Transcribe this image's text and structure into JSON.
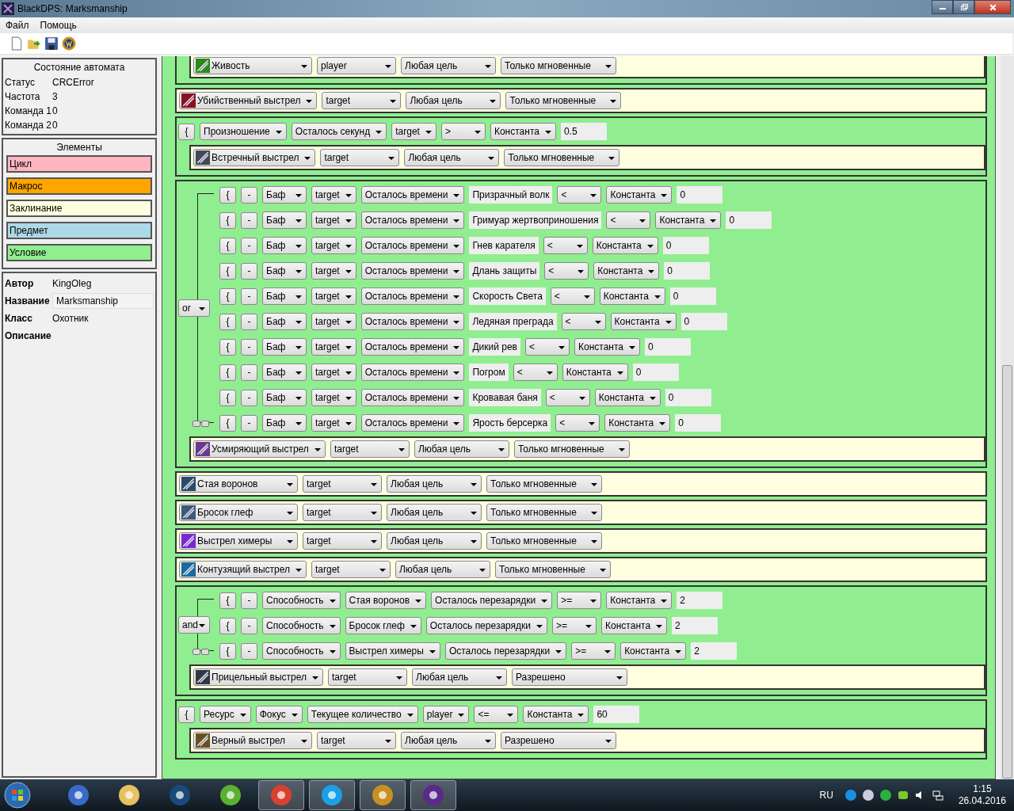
{
  "window": {
    "title": "BlackDPS: Marksmanship"
  },
  "menu": [
    "Файл",
    "Помощь"
  ],
  "status": {
    "title": "Состояние автомата",
    "rows": [
      {
        "label": "Статус",
        "value": "CRCError"
      },
      {
        "label": "Частота",
        "value": "3"
      },
      {
        "label": "Команда 1",
        "value": "0"
      },
      {
        "label": "Команда 2",
        "value": "0"
      }
    ]
  },
  "elements": {
    "title": "Элементы",
    "items": [
      {
        "label": "Цикл",
        "color": "#ffb6c1"
      },
      {
        "label": "Макрос",
        "color": "#ffa500"
      },
      {
        "label": "Заклинание",
        "color": "#ffffe0"
      },
      {
        "label": "Предмет",
        "color": "#add8e6"
      },
      {
        "label": "Условие",
        "color": "#90ee90"
      }
    ]
  },
  "info": {
    "author_label": "Автор",
    "author": "KingOleg",
    "name_label": "Название",
    "name": "Marksmanship",
    "class_label": "Класс",
    "class": "Охотник",
    "description_label": "Описание"
  },
  "blocks": [
    {
      "kind": "condition",
      "cut": true,
      "spell": {
        "name": "Живость",
        "unit": "player",
        "target": "Любая цель",
        "mode": "Только мгновенные"
      }
    },
    {
      "kind": "spell",
      "spell": {
        "name": "Убийственный выстрел",
        "unit": "target",
        "target": "Любая цель",
        "mode": "Только мгновенные"
      }
    },
    {
      "kind": "condition",
      "conditions": [
        {
          "fields": [
            {
              "kind": "button",
              "text": "{"
            },
            {
              "kind": "select",
              "text": "Произношение"
            },
            {
              "kind": "select",
              "text": "Осталось секунд"
            },
            {
              "kind": "select",
              "text": "target"
            },
            {
              "kind": "select",
              "text": ">"
            },
            {
              "kind": "select",
              "text": "Константа"
            },
            {
              "kind": "input",
              "text": "0.5"
            }
          ]
        }
      ],
      "spell": {
        "name": "Встречный выстрел",
        "unit": "target",
        "target": "Любая цель",
        "mode": "Только мгновенные"
      }
    },
    {
      "kind": "condition",
      "logic": "or",
      "conditions": [
        {
          "fields": [
            {
              "kind": "button",
              "text": "{"
            },
            {
              "kind": "button",
              "text": "-"
            },
            {
              "kind": "select",
              "text": "Баф"
            },
            {
              "kind": "select",
              "text": "target"
            },
            {
              "kind": "select",
              "text": "Осталось времени"
            },
            {
              "kind": "label",
              "text": "Призрачный волк"
            },
            {
              "kind": "select",
              "text": "<"
            },
            {
              "kind": "select",
              "text": "Константа"
            },
            {
              "kind": "input",
              "text": "0"
            }
          ]
        },
        {
          "fields": [
            {
              "kind": "button",
              "text": "{"
            },
            {
              "kind": "button",
              "text": "-"
            },
            {
              "kind": "select",
              "text": "Баф"
            },
            {
              "kind": "select",
              "text": "target"
            },
            {
              "kind": "select",
              "text": "Осталось времени"
            },
            {
              "kind": "label",
              "text": "Гримуар жертвоприношения"
            },
            {
              "kind": "select",
              "text": "<"
            },
            {
              "kind": "select",
              "text": "Константа"
            },
            {
              "kind": "input",
              "text": "0"
            }
          ]
        },
        {
          "fields": [
            {
              "kind": "button",
              "text": "{"
            },
            {
              "kind": "button",
              "text": "-"
            },
            {
              "kind": "select",
              "text": "Баф"
            },
            {
              "kind": "select",
              "text": "target"
            },
            {
              "kind": "select",
              "text": "Осталось времени"
            },
            {
              "kind": "label",
              "text": "Гнев карателя"
            },
            {
              "kind": "select",
              "text": "<"
            },
            {
              "kind": "select",
              "text": "Константа"
            },
            {
              "kind": "input",
              "text": "0"
            }
          ]
        },
        {
          "fields": [
            {
              "kind": "button",
              "text": "{"
            },
            {
              "kind": "button",
              "text": "-"
            },
            {
              "kind": "select",
              "text": "Баф"
            },
            {
              "kind": "select",
              "text": "target"
            },
            {
              "kind": "select",
              "text": "Осталось времени"
            },
            {
              "kind": "label",
              "text": "Длань защиты"
            },
            {
              "kind": "select",
              "text": "<"
            },
            {
              "kind": "select",
              "text": "Константа"
            },
            {
              "kind": "input",
              "text": "0"
            }
          ]
        },
        {
          "fields": [
            {
              "kind": "button",
              "text": "{"
            },
            {
              "kind": "button",
              "text": "-"
            },
            {
              "kind": "select",
              "text": "Баф"
            },
            {
              "kind": "select",
              "text": "target"
            },
            {
              "kind": "select",
              "text": "Осталось времени"
            },
            {
              "kind": "label",
              "text": "Скорость Света"
            },
            {
              "kind": "select",
              "text": "<"
            },
            {
              "kind": "select",
              "text": "Константа"
            },
            {
              "kind": "input",
              "text": "0"
            }
          ]
        },
        {
          "fields": [
            {
              "kind": "button",
              "text": "{"
            },
            {
              "kind": "button",
              "text": "-"
            },
            {
              "kind": "select",
              "text": "Баф"
            },
            {
              "kind": "select",
              "text": "target"
            },
            {
              "kind": "select",
              "text": "Осталось времени"
            },
            {
              "kind": "label",
              "text": "Ледяная преграда"
            },
            {
              "kind": "select",
              "text": "<"
            },
            {
              "kind": "select",
              "text": "Константа"
            },
            {
              "kind": "input",
              "text": "0"
            }
          ]
        },
        {
          "fields": [
            {
              "kind": "button",
              "text": "{"
            },
            {
              "kind": "button",
              "text": "-"
            },
            {
              "kind": "select",
              "text": "Баф"
            },
            {
              "kind": "select",
              "text": "target"
            },
            {
              "kind": "select",
              "text": "Осталось времени"
            },
            {
              "kind": "label",
              "text": "Дикий рев"
            },
            {
              "kind": "select",
              "text": "<"
            },
            {
              "kind": "select",
              "text": "Константа"
            },
            {
              "kind": "input",
              "text": "0"
            }
          ]
        },
        {
          "fields": [
            {
              "kind": "button",
              "text": "{"
            },
            {
              "kind": "button",
              "text": "-"
            },
            {
              "kind": "select",
              "text": "Баф"
            },
            {
              "kind": "select",
              "text": "target"
            },
            {
              "kind": "select",
              "text": "Осталось времени"
            },
            {
              "kind": "label",
              "text": "Погром"
            },
            {
              "kind": "select",
              "text": "<"
            },
            {
              "kind": "select",
              "text": "Константа"
            },
            {
              "kind": "input",
              "text": "0"
            }
          ]
        },
        {
          "fields": [
            {
              "kind": "button",
              "text": "{"
            },
            {
              "kind": "button",
              "text": "-"
            },
            {
              "kind": "select",
              "text": "Баф"
            },
            {
              "kind": "select",
              "text": "target"
            },
            {
              "kind": "select",
              "text": "Осталось времени"
            },
            {
              "kind": "label",
              "text": "Кровавая баня"
            },
            {
              "kind": "select",
              "text": "<"
            },
            {
              "kind": "select",
              "text": "Константа"
            },
            {
              "kind": "input",
              "text": "0"
            }
          ]
        },
        {
          "fields": [
            {
              "kind": "button",
              "text": "{"
            },
            {
              "kind": "button",
              "text": "-"
            },
            {
              "kind": "select",
              "text": "Баф"
            },
            {
              "kind": "select",
              "text": "target"
            },
            {
              "kind": "select",
              "text": "Осталось времени"
            },
            {
              "kind": "label",
              "text": "Ярость берсерка"
            },
            {
              "kind": "select",
              "text": "<"
            },
            {
              "kind": "select",
              "text": "Константа"
            },
            {
              "kind": "input",
              "text": "0"
            }
          ]
        }
      ],
      "spell": {
        "name": "Усмиряющий выстрел",
        "unit": "target",
        "target": "Любая цель",
        "mode": "Только мгновенные"
      }
    },
    {
      "kind": "spell",
      "spell": {
        "name": "Стая воронов",
        "unit": "target",
        "target": "Любая цель",
        "mode": "Только мгновенные"
      }
    },
    {
      "kind": "spell",
      "spell": {
        "name": "Бросок глеф",
        "unit": "target",
        "target": "Любая цель",
        "mode": "Только мгновенные"
      }
    },
    {
      "kind": "spell",
      "spell": {
        "name": "Выстрел химеры",
        "unit": "target",
        "target": "Любая цель",
        "mode": "Только мгновенные"
      }
    },
    {
      "kind": "spell",
      "spell": {
        "name": "Контузящий выстрел",
        "unit": "target",
        "target": "Любая цель",
        "mode": "Только мгновенные"
      }
    },
    {
      "kind": "condition",
      "logic": "and",
      "conditions": [
        {
          "fields": [
            {
              "kind": "button",
              "text": "{"
            },
            {
              "kind": "button",
              "text": "-"
            },
            {
              "kind": "select",
              "text": "Способность"
            },
            {
              "kind": "select",
              "text": "Стая воронов"
            },
            {
              "kind": "select",
              "text": "Осталось перезарядки"
            },
            {
              "kind": "select",
              "text": ">="
            },
            {
              "kind": "select",
              "text": "Константа"
            },
            {
              "kind": "input",
              "text": "2"
            }
          ]
        },
        {
          "fields": [
            {
              "kind": "button",
              "text": "{"
            },
            {
              "kind": "button",
              "text": "-"
            },
            {
              "kind": "select",
              "text": "Способность"
            },
            {
              "kind": "select",
              "text": "Бросок глеф"
            },
            {
              "kind": "select",
              "text": "Осталось перезарядки"
            },
            {
              "kind": "select",
              "text": ">="
            },
            {
              "kind": "select",
              "text": "Константа"
            },
            {
              "kind": "input",
              "text": "2"
            }
          ]
        },
        {
          "fields": [
            {
              "kind": "button",
              "text": "{"
            },
            {
              "kind": "button",
              "text": "-"
            },
            {
              "kind": "select",
              "text": "Способность"
            },
            {
              "kind": "select",
              "text": "Выстрел химеры"
            },
            {
              "kind": "select",
              "text": "Осталось перезарядки"
            },
            {
              "kind": "select",
              "text": ">="
            },
            {
              "kind": "select",
              "text": "Константа"
            },
            {
              "kind": "input",
              "text": "2"
            }
          ]
        }
      ],
      "spell": {
        "name": "Прицельный выстрел",
        "unit": "target",
        "target": "Любая цель",
        "mode": "Разрешено"
      }
    },
    {
      "kind": "condition",
      "conditions": [
        {
          "fields": [
            {
              "kind": "button",
              "text": "{"
            },
            {
              "kind": "select",
              "text": "Ресурс"
            },
            {
              "kind": "select",
              "text": "Фокус"
            },
            {
              "kind": "select",
              "text": "Текущее количество"
            },
            {
              "kind": "select",
              "text": "player"
            },
            {
              "kind": "select",
              "text": "<="
            },
            {
              "kind": "select",
              "text": "Константа"
            },
            {
              "kind": "input",
              "text": "60"
            }
          ]
        }
      ],
      "spell": {
        "name": "Верный выстрел",
        "unit": "target",
        "target": "Любая цель",
        "mode": "Разрешено"
      }
    }
  ],
  "taskbar": {
    "apps": [
      {
        "kind": "paint",
        "selected": false
      },
      {
        "kind": "folder",
        "selected": false
      },
      {
        "kind": "gear",
        "selected": false
      },
      {
        "kind": "torrent",
        "selected": false
      },
      {
        "kind": "chrome",
        "selected": true
      },
      {
        "kind": "skype",
        "selected": true
      },
      {
        "kind": "game",
        "selected": true
      },
      {
        "kind": "app",
        "selected": true
      }
    ],
    "language": "RU",
    "time": "1:15",
    "date": "26.04.2016"
  }
}
